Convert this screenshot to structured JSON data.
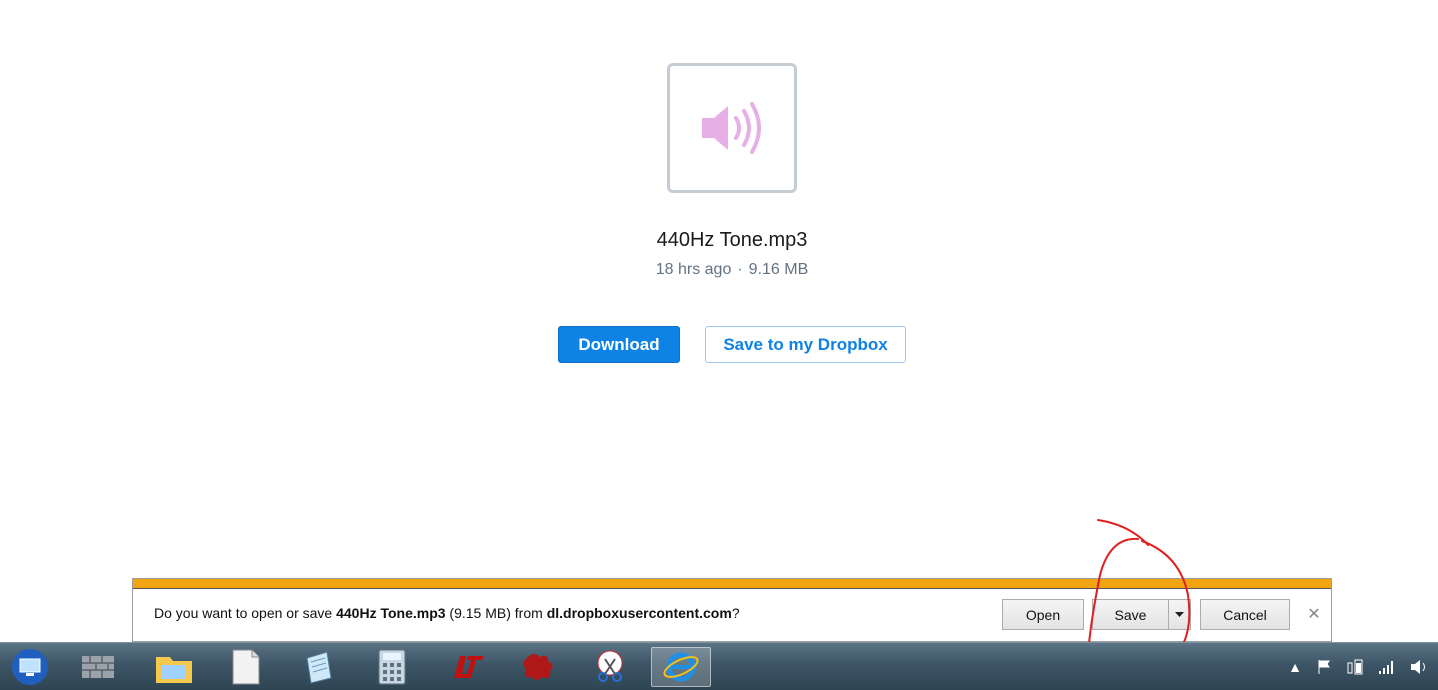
{
  "file": {
    "name": "440Hz Tone.mp3",
    "age": "18 hrs ago",
    "separator": "·",
    "size": "9.16 MB",
    "icon": "speaker-icon"
  },
  "actions": {
    "download_label": "Download",
    "save_dropbox_label": "Save to my Dropbox"
  },
  "notification": {
    "prefix": "Do you want to open or save ",
    "file": "440Hz Tone.mp3",
    "size": " (9.15 MB) from ",
    "host": "dl.dropboxusercontent.com",
    "suffix": "?",
    "open_label": "Open",
    "save_label": "Save",
    "cancel_label": "Cancel",
    "close_glyph": "✕",
    "accent_color": "#f2a413"
  },
  "taskbar": {
    "items": [
      {
        "icon": "remote-desktop-icon"
      },
      {
        "icon": "firewall-icon"
      },
      {
        "icon": "file-explorer-icon"
      },
      {
        "icon": "blank-document-icon"
      },
      {
        "icon": "notepad-icon"
      },
      {
        "icon": "calculator-icon"
      },
      {
        "icon": "app-logo-icon"
      },
      {
        "icon": "paint-splat-icon"
      },
      {
        "icon": "snipping-tool-icon"
      },
      {
        "icon": "internet-explorer-icon"
      }
    ],
    "tray": [
      "show-hidden-icons",
      "action-center-flag-icon",
      "power-icon",
      "network-signal-icon",
      "volume-icon"
    ]
  }
}
